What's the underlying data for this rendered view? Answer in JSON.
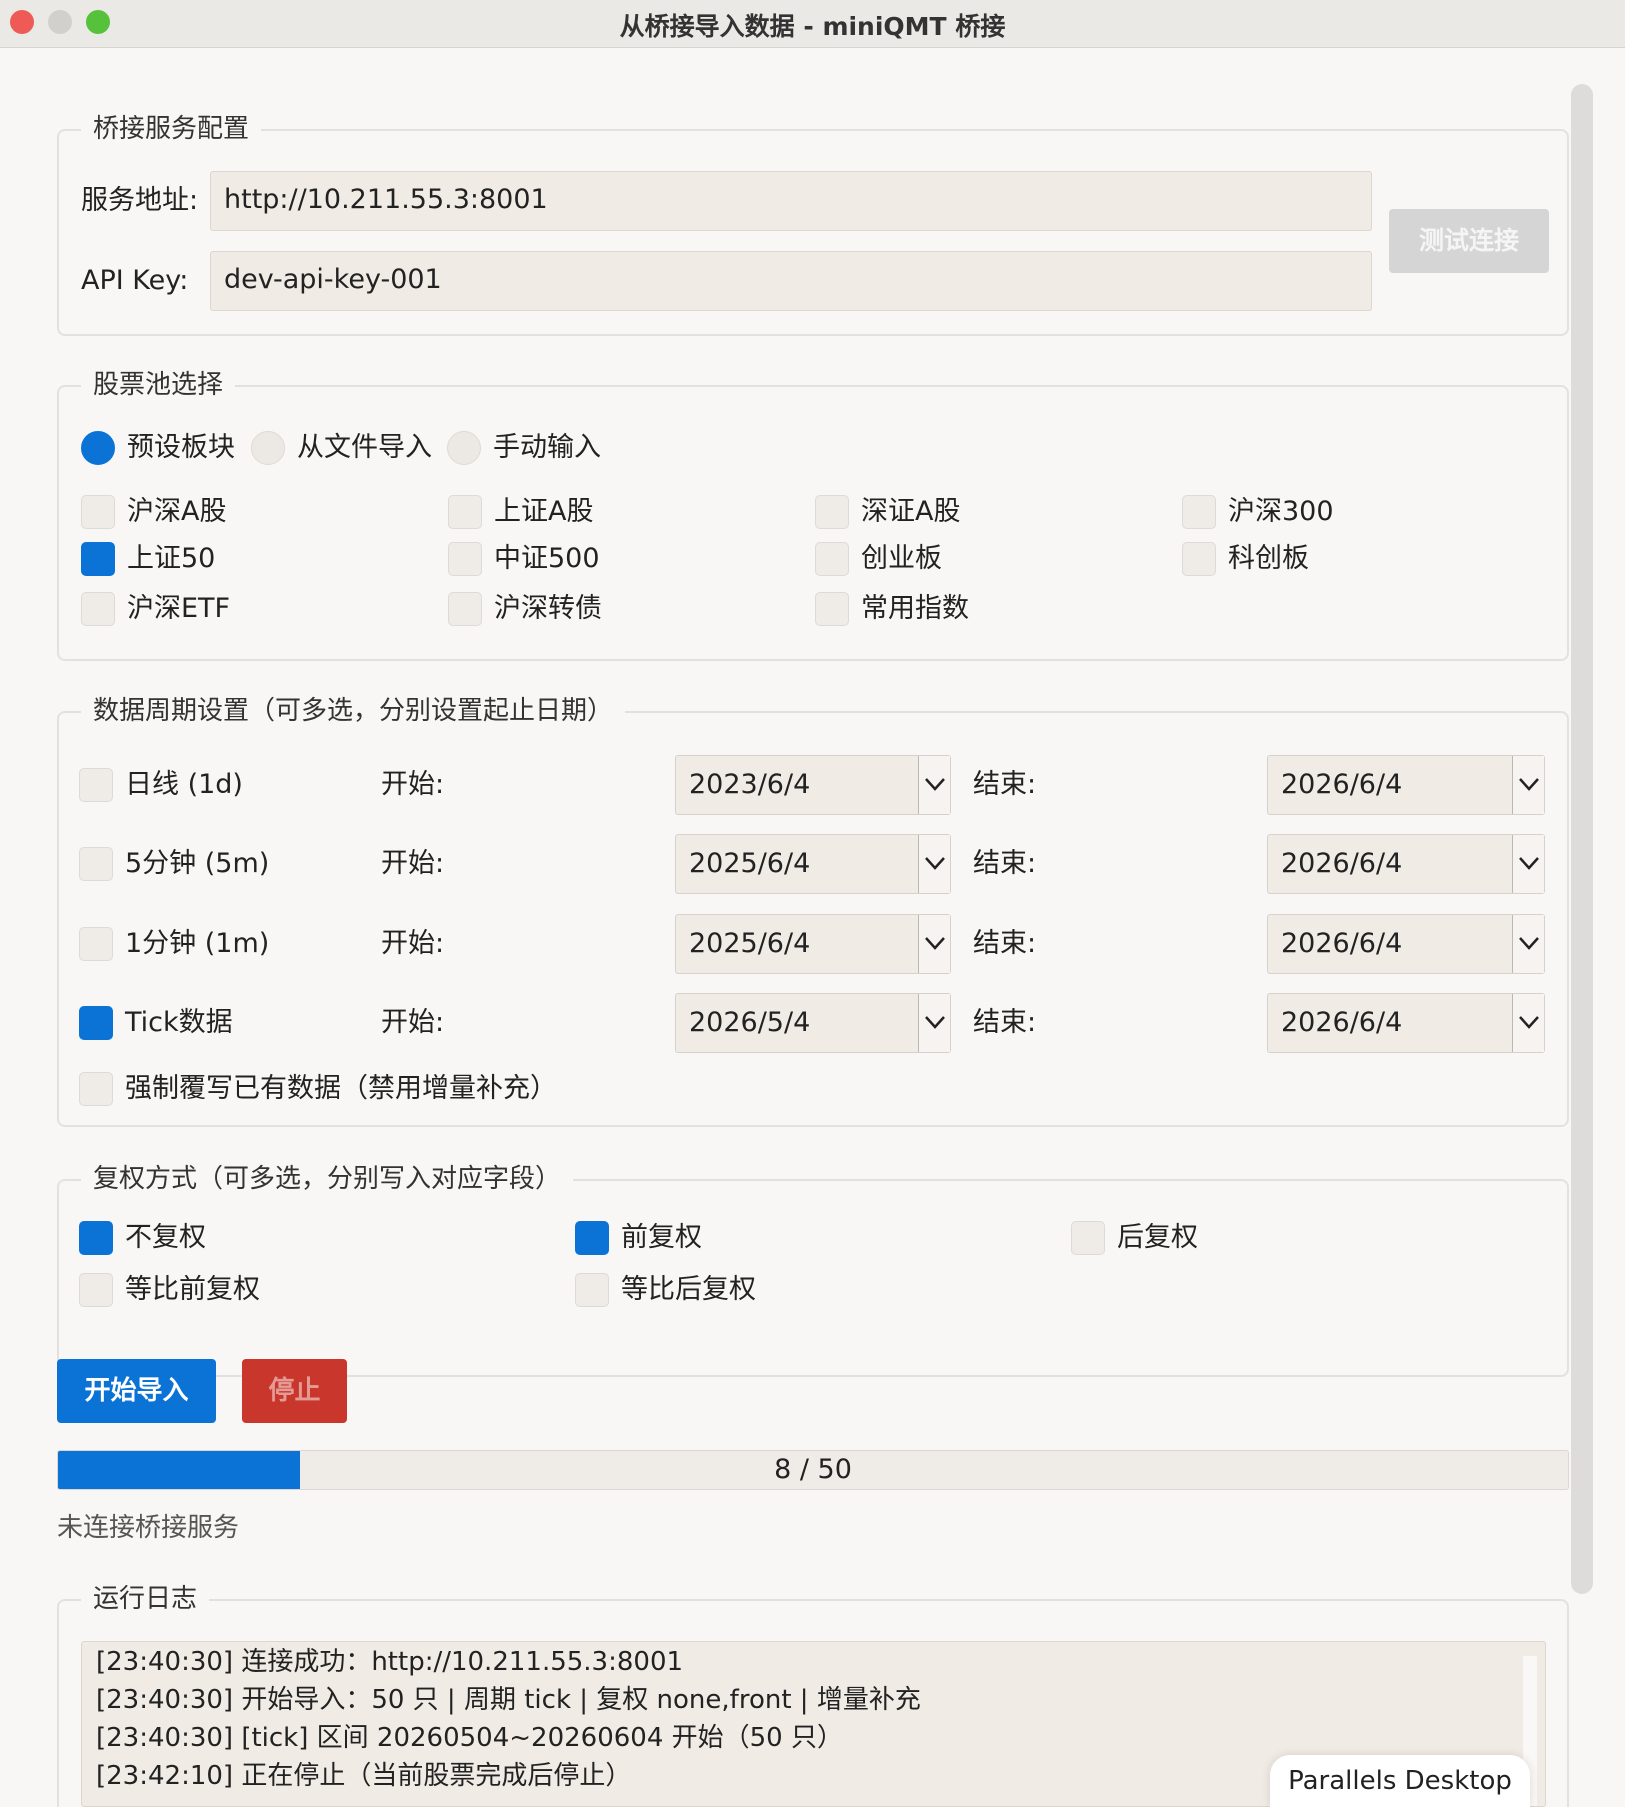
{
  "window": {
    "title": "从桥接导入数据 - miniQMT 桥接"
  },
  "bridge_config": {
    "legend": "桥接服务配置",
    "address_label": "服务地址:",
    "address_value": "http://10.211.55.3:8001",
    "apikey_label": "API Key:",
    "apikey_value": "dev-api-key-001",
    "test_button": "测试连接"
  },
  "stock_pool": {
    "legend": "股票池选择",
    "modes": [
      {
        "label": "预设板块",
        "selected": true
      },
      {
        "label": "从文件导入",
        "selected": false
      },
      {
        "label": "手动输入",
        "selected": false
      }
    ],
    "boards": [
      {
        "label": "沪深A股",
        "checked": false
      },
      {
        "label": "上证A股",
        "checked": false
      },
      {
        "label": "深证A股",
        "checked": false
      },
      {
        "label": "沪深300",
        "checked": false
      },
      {
        "label": "上证50",
        "checked": true
      },
      {
        "label": "中证500",
        "checked": false
      },
      {
        "label": "创业板",
        "checked": false
      },
      {
        "label": "科创板",
        "checked": false
      },
      {
        "label": "沪深ETF",
        "checked": false
      },
      {
        "label": "沪深转债",
        "checked": false
      },
      {
        "label": "常用指数",
        "checked": false
      }
    ]
  },
  "periods": {
    "legend": "数据周期设置（可多选，分别设置起止日期）",
    "start_label": "开始:",
    "end_label": "结束:",
    "rows": [
      {
        "label": "日线 (1d)",
        "checked": false,
        "start": "2023/6/4",
        "end": "2026/6/4"
      },
      {
        "label": "5分钟 (5m)",
        "checked": false,
        "start": "2025/6/4",
        "end": "2026/6/4"
      },
      {
        "label": "1分钟 (1m)",
        "checked": false,
        "start": "2025/6/4",
        "end": "2026/6/4"
      },
      {
        "label": "Tick数据",
        "checked": true,
        "start": "2026/5/4",
        "end": "2026/6/4"
      }
    ],
    "overwrite_label": "强制覆写已有数据（禁用增量补充）",
    "overwrite_checked": false
  },
  "adjust": {
    "legend": "复权方式（可多选，分别写入对应字段）",
    "options": [
      {
        "label": "不复权",
        "checked": true
      },
      {
        "label": "前复权",
        "checked": true
      },
      {
        "label": "后复权",
        "checked": false
      },
      {
        "label": "等比前复权",
        "checked": false
      },
      {
        "label": "等比后复权",
        "checked": false
      }
    ]
  },
  "actions": {
    "start": "开始导入",
    "stop": "停止"
  },
  "progress": {
    "text": "8 / 50",
    "fraction": 0.16
  },
  "status": "未连接桥接服务",
  "log": {
    "legend": "运行日志",
    "lines": [
      "[23:40:30] 连接成功：http://10.211.55.3:8001",
      "[23:40:30] 开始导入：50 只 | 周期 tick | 复权 none,front | 增量补充",
      "[23:40:30] [tick] 区间 20260504~20260604 开始（50 只）",
      "[23:42:10] 正在停止（当前股票完成后停止）"
    ]
  },
  "overlay": {
    "parallels": "Parallels Desktop"
  },
  "colors": {
    "accent": "#0b73d6",
    "stop": "#c9362c"
  }
}
